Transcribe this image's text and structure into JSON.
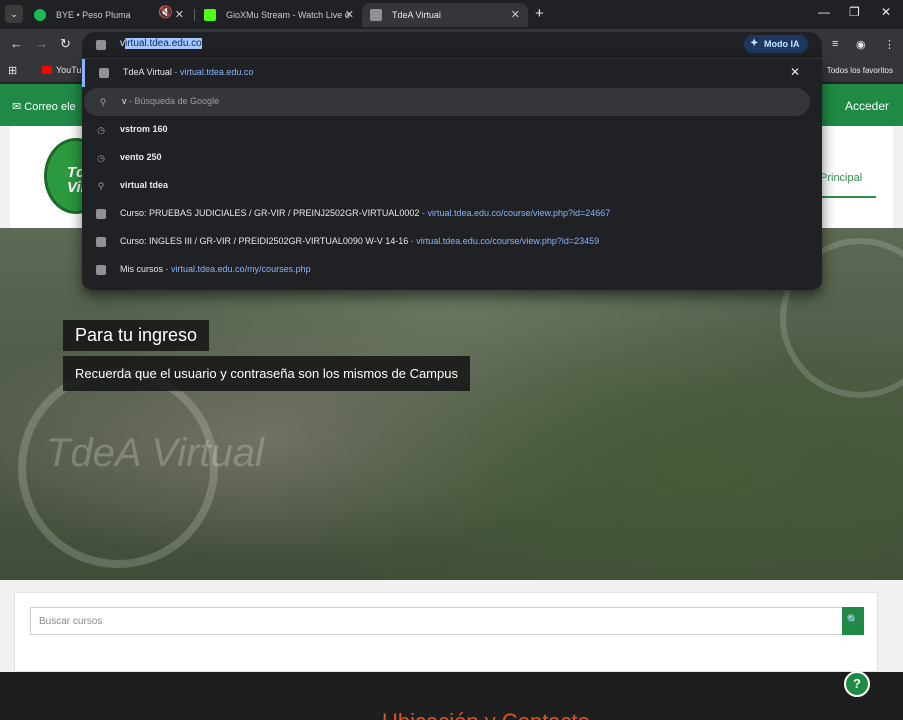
{
  "browser": {
    "tabs": [
      {
        "title": "BYE • Peso Pluma",
        "favicon_color": "#1db954",
        "audio": false
      },
      {
        "title": "GioXMu Stream - Watch Live o",
        "favicon_color": "#53fc18",
        "audio": true
      },
      {
        "title": "TdeA Virtual",
        "favicon_color": "#8e9196",
        "audio": false,
        "active": true
      }
    ],
    "address": {
      "prefix": "v",
      "selected": "irtual.tdea.edu.co"
    },
    "modo_ia": "Modo IA",
    "bookmarks": {
      "youtube": "YouTu",
      "all": "Todos los favoritos"
    }
  },
  "omnibox_suggestions": [
    {
      "type": "site",
      "main": "TdeA Virtual",
      "sep": " - ",
      "url": "virtual.tdea.edu.co",
      "closable": true
    },
    {
      "type": "search",
      "main": "v",
      "sep": " - ",
      "detail": "Búsqueda de Google"
    },
    {
      "type": "history",
      "main": "vstrom 160"
    },
    {
      "type": "history",
      "main": "vento 250"
    },
    {
      "type": "search",
      "main": "virtual tdea"
    },
    {
      "type": "site",
      "main": "Curso: PRUEBAS JUDICIALES / GR-VIR / PREINJ2502GR-VIRTUAL0002",
      "sep": " - ",
      "url": "virtual.tdea.edu.co/course/view.php?id=24667"
    },
    {
      "type": "site",
      "main": "Curso: INGLES III / GR-VIR / PREIDI2502GR-VIRTUAL0090 W-V 14-16",
      "sep": " - ",
      "url": "virtual.tdea.edu.co/course/view.php?id=23459"
    },
    {
      "type": "site",
      "main": "Mis cursos",
      "sep": " - ",
      "url": "virtual.tdea.edu.co/my/courses.php"
    }
  ],
  "page": {
    "topbar": {
      "correo": "Correo ele",
      "acceder": "Acceder"
    },
    "logo": {
      "line1": "Tde",
      "line2": "Virt"
    },
    "nav_principal": "Principal",
    "hero": {
      "title": "Para tu ingreso",
      "subtitle": "Recuerda que el usuario y contraseña son los mismos de Campus",
      "watermark": "TdeA Virtual"
    },
    "search": {
      "placeholder": "Buscar cursos"
    },
    "footer_heading": "Ubicación y Contacto"
  },
  "colors": {
    "brand_green": "#1e8a45",
    "link_blue": "#8ab4f8",
    "footer_orange": "#d9542b"
  }
}
